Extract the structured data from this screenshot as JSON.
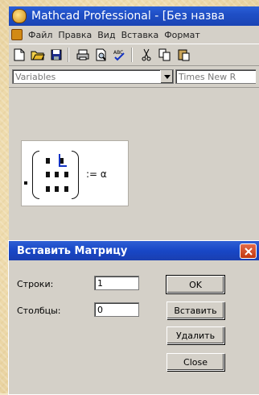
{
  "window": {
    "title": "Mathcad Professional - [Без назва"
  },
  "menu": [
    "Файл",
    "Правка",
    "Вид",
    "Вставка",
    "Формат"
  ],
  "toolbar": {
    "icons": [
      "new-document-icon",
      "open-folder-icon",
      "save-icon",
      "print-icon",
      "print-preview-icon",
      "spell-check-icon",
      "cut-icon",
      "copy-icon",
      "paste-icon"
    ]
  },
  "formatbar": {
    "style_value": "Variables",
    "font_value": "Times New R"
  },
  "worksheet": {
    "assignment_text": ":= α"
  },
  "dialog": {
    "title": "Вставить Матрицу",
    "rows_label": "Строки:",
    "rows_value": "1",
    "cols_label": "Столбцы:",
    "cols_value": "0",
    "ok_label": "OK",
    "insert_label": "Вставить",
    "delete_label": "Удалить",
    "close_label": "Close"
  },
  "colors": {
    "titlebar": "#1f4fc6",
    "chrome": "#d4d0c8",
    "cursor": "#1233c4"
  }
}
